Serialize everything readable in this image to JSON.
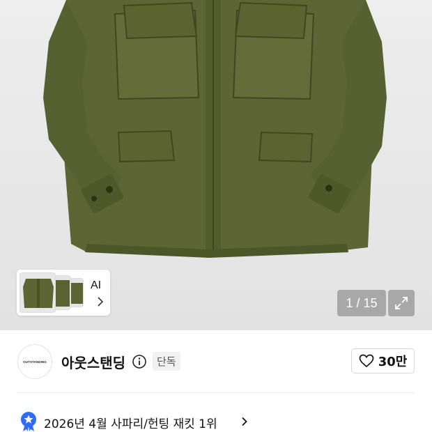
{
  "gallery": {
    "thumbnail_label": "AI",
    "counter": "1 / 15",
    "icons": [
      "chevron-right-icon",
      "expand-icon"
    ]
  },
  "brand": {
    "logo_text": "OUTSTANDING",
    "name": "아웃스탠딩",
    "exclusive_badge": "단독",
    "like_count": "30만",
    "icons": [
      "info-icon",
      "heart-icon"
    ]
  },
  "ranking": {
    "text": "2026년 4월 사파리/헌팅 재킷 1위",
    "badge_color": "#2f6bff",
    "icons": [
      "star-badge-icon",
      "chevron-right-icon"
    ]
  }
}
